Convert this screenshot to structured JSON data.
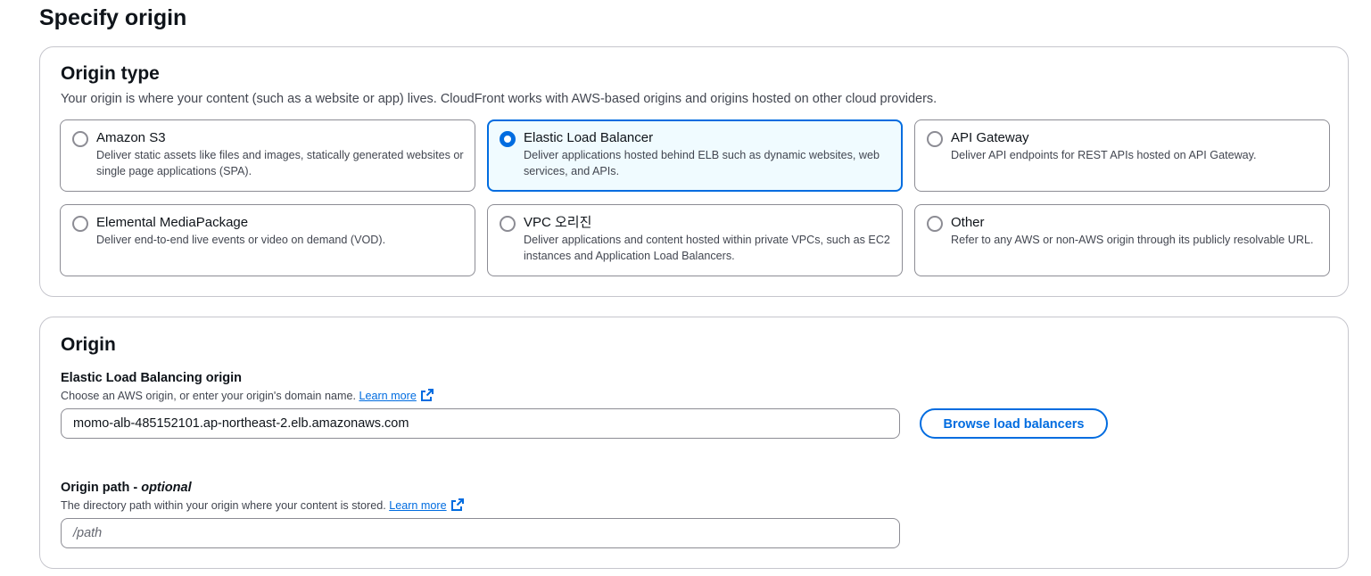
{
  "page": {
    "title": "Specify origin"
  },
  "origin_type": {
    "heading": "Origin type",
    "description": "Your origin is where your content (such as a website or app) lives. CloudFront works with AWS-based origins and origins hosted on other cloud providers.",
    "options": [
      {
        "title": "Amazon S3",
        "description": "Deliver static assets like files and images, statically generated websites or single page applications (SPA).",
        "selected": false
      },
      {
        "title": "Elastic Load Balancer",
        "description": "Deliver applications hosted behind ELB such as dynamic websites, web services, and APIs.",
        "selected": true
      },
      {
        "title": "API Gateway",
        "description": "Deliver API endpoints for REST APIs hosted on API Gateway.",
        "selected": false
      },
      {
        "title": "Elemental MediaPackage",
        "description": "Deliver end-to-end live events or video on demand (VOD).",
        "selected": false
      },
      {
        "title": "VPC 오리진",
        "description": "Deliver applications and content hosted within private VPCs, such as EC2 instances and Application Load Balancers.",
        "selected": false
      },
      {
        "title": "Other",
        "description": "Refer to any AWS or non-AWS origin through its publicly resolvable URL.",
        "selected": false
      }
    ]
  },
  "origin": {
    "heading": "Origin",
    "elb_origin": {
      "label": "Elastic Load Balancing origin",
      "description": "Choose an AWS origin, or enter your origin's domain name.",
      "learn_more": "Learn more",
      "value": "momo-alb-485152101.ap-northeast-2.elb.amazonaws.com",
      "browse_button": "Browse load balancers"
    },
    "origin_path": {
      "label": "Origin path -",
      "label_optional": "optional",
      "description": "The directory path within your origin where your content is stored.",
      "learn_more": "Learn more",
      "placeholder": "/path",
      "value": ""
    }
  },
  "colors": {
    "accent": "#006ce0",
    "selected_bg": "#f0fbff",
    "border": "#8c8c94",
    "text_secondary": "#424650"
  },
  "icons": {
    "external_link": "external-link-icon"
  }
}
